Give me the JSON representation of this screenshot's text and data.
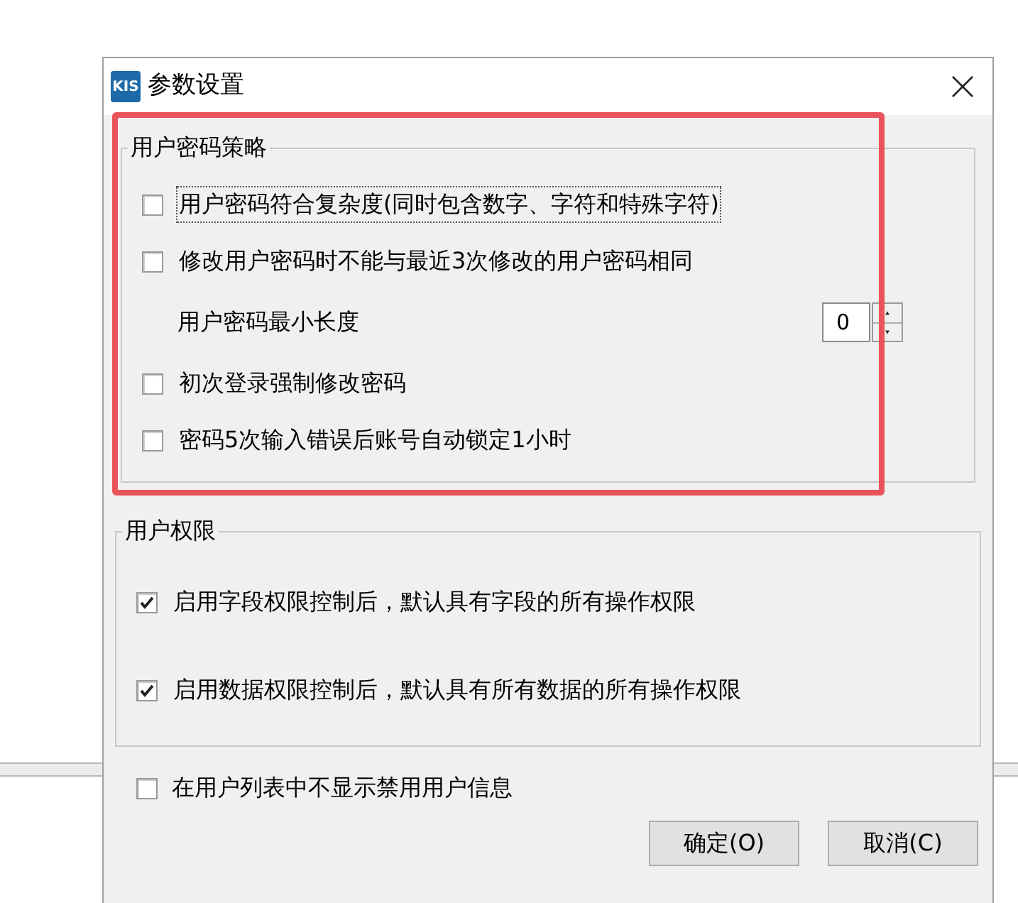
{
  "window": {
    "title": "参数设置",
    "icon_text": "KIS"
  },
  "groups": [
    {
      "title": "用户密码策略",
      "highlighted": true,
      "items": [
        {
          "kind": "checkbox",
          "label": "用户密码符合复杂度(同时包含数字、字符和特殊字符)",
          "checked": false,
          "focused": true
        },
        {
          "kind": "checkbox",
          "label": "修改用户密码时不能与最近3次修改的用户密码相同",
          "checked": false,
          "focused": false
        },
        {
          "kind": "spinner",
          "label": "用户密码最小长度",
          "value": "0"
        },
        {
          "kind": "checkbox",
          "label": "初次登录强制修改密码",
          "checked": false,
          "focused": false
        },
        {
          "kind": "checkbox",
          "label": "密码5次输入错误后账号自动锁定1小时",
          "checked": false,
          "focused": false
        }
      ]
    },
    {
      "title": "用户权限",
      "highlighted": false,
      "items": [
        {
          "kind": "checkbox",
          "label": "启用字段权限控制后，默认具有字段的所有操作权限",
          "checked": true,
          "focused": false
        },
        {
          "kind": "checkbox",
          "label": "启用数据权限控制后，默认具有所有数据的所有操作权限",
          "checked": true,
          "focused": false
        }
      ]
    }
  ],
  "extra_option": {
    "label": "在用户列表中不显示禁用用户信息",
    "checked": false
  },
  "buttons": [
    {
      "label": "确定(O)"
    },
    {
      "label": "取消(C)"
    }
  ]
}
